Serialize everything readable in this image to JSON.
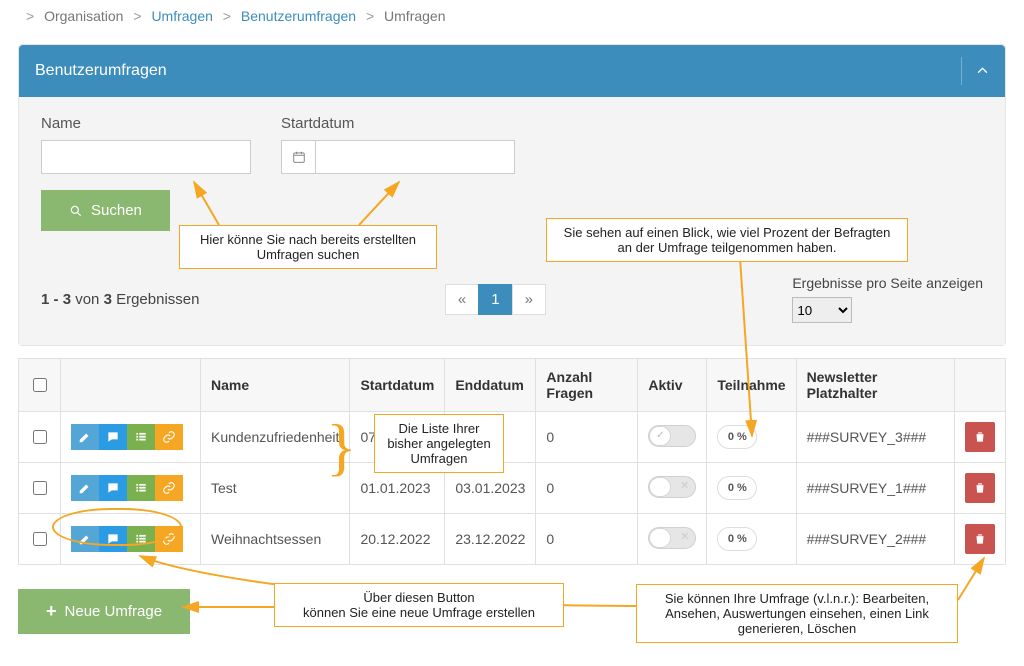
{
  "breadcrumb": [
    "Organisation",
    "Umfragen",
    "Benutzerumfragen",
    "Umfragen"
  ],
  "panel": {
    "title": "Benutzerumfragen"
  },
  "filters": {
    "name_label": "Name",
    "date_label": "Startdatum",
    "search_btn": "Suchen"
  },
  "results": {
    "from": "1",
    "to": "3",
    "total": "3",
    "label_von": "von",
    "label_erg": "Ergebnissen",
    "page_current": "1",
    "perpage_label": "Ergebnisse pro Seite anzeigen",
    "perpage_value": "10"
  },
  "table": {
    "headers": {
      "name": "Name",
      "start": "Startdatum",
      "end": "Enddatum",
      "count": "Anzahl Fragen",
      "active": "Aktiv",
      "part": "Teilnahme",
      "newsletter": "Newsletter Platzhalter"
    },
    "rows": [
      {
        "name": "Kundenzufriedenheit",
        "start": "07.",
        "end": "23",
        "count": "0",
        "active": true,
        "pct": "0 %",
        "newsletter": "###SURVEY_3###"
      },
      {
        "name": "Test",
        "start": "01.01.2023",
        "end": "03.01.2023",
        "count": "0",
        "active": false,
        "pct": "0 %",
        "newsletter": "###SURVEY_1###"
      },
      {
        "name": "Weihnachtsessen",
        "start": "20.12.2022",
        "end": "23.12.2022",
        "count": "0",
        "active": false,
        "pct": "0 %",
        "newsletter": "###SURVEY_2###"
      }
    ]
  },
  "new_btn": "Neue Umfrage",
  "callouts": {
    "c1": "Hier könne Sie nach bereits erstellten\nUmfragen suchen",
    "c2": "Sie sehen auf einen Blick, wie viel Prozent der Befragten\nan der Umfrage teilgenommen haben.",
    "c3": "Die Liste Ihrer\nbisher angelegten\nUmfragen",
    "c4": "Über diesen Button\nkönnen Sie eine neue Umfrage erstellen",
    "c5": "Sie können Ihre Umfrage (v.l.n.r.): Bearbeiten,\nAnsehen, Auswertungen einsehen, einen Link\ngenerieren, Löschen"
  }
}
